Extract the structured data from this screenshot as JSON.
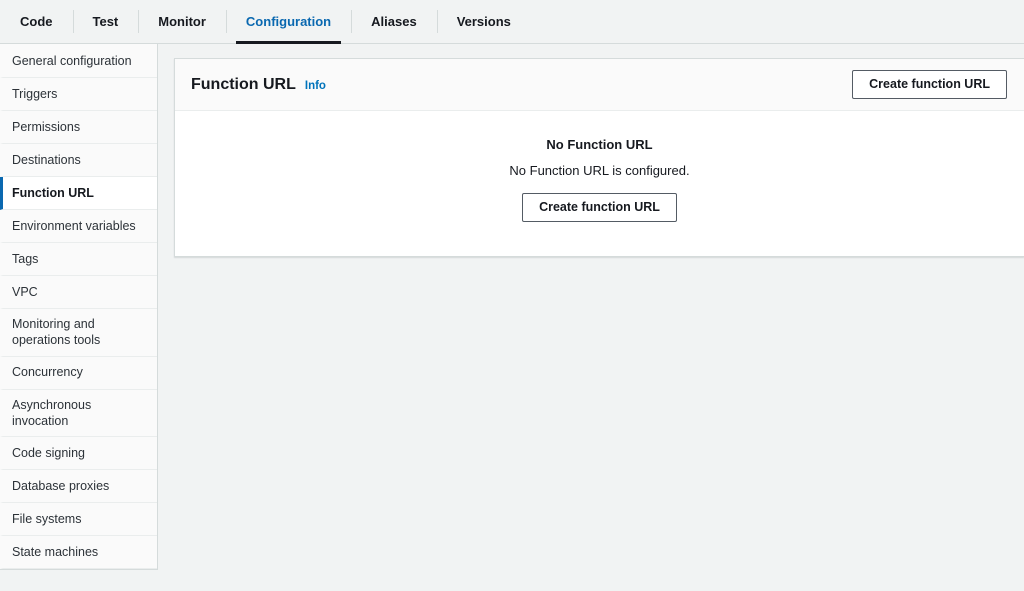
{
  "tabs": [
    {
      "label": "Code",
      "active": false
    },
    {
      "label": "Test",
      "active": false
    },
    {
      "label": "Monitor",
      "active": false
    },
    {
      "label": "Configuration",
      "active": true
    },
    {
      "label": "Aliases",
      "active": false
    },
    {
      "label": "Versions",
      "active": false
    }
  ],
  "sidebar": {
    "items": [
      {
        "label": "General configuration",
        "selected": false
      },
      {
        "label": "Triggers",
        "selected": false
      },
      {
        "label": "Permissions",
        "selected": false
      },
      {
        "label": "Destinations",
        "selected": false
      },
      {
        "label": "Function URL",
        "selected": true
      },
      {
        "label": "Environment variables",
        "selected": false
      },
      {
        "label": "Tags",
        "selected": false
      },
      {
        "label": "VPC",
        "selected": false
      },
      {
        "label": "Monitoring and operations tools",
        "selected": false
      },
      {
        "label": "Concurrency",
        "selected": false
      },
      {
        "label": "Asynchronous invocation",
        "selected": false
      },
      {
        "label": "Code signing",
        "selected": false
      },
      {
        "label": "Database proxies",
        "selected": false
      },
      {
        "label": "File systems",
        "selected": false
      },
      {
        "label": "State machines",
        "selected": false
      }
    ]
  },
  "panel": {
    "title": "Function URL",
    "info_label": "Info",
    "create_button_label": "Create function URL",
    "empty_state": {
      "title": "No Function URL",
      "description": "No Function URL is configured.",
      "button_label": "Create function URL"
    }
  },
  "colors": {
    "accent_blue": "#0a68b0",
    "link_blue": "#0073bb",
    "page_background": "#f1f3f3",
    "border": "#d5dbdb",
    "active_tab_underline": "#16191f"
  }
}
